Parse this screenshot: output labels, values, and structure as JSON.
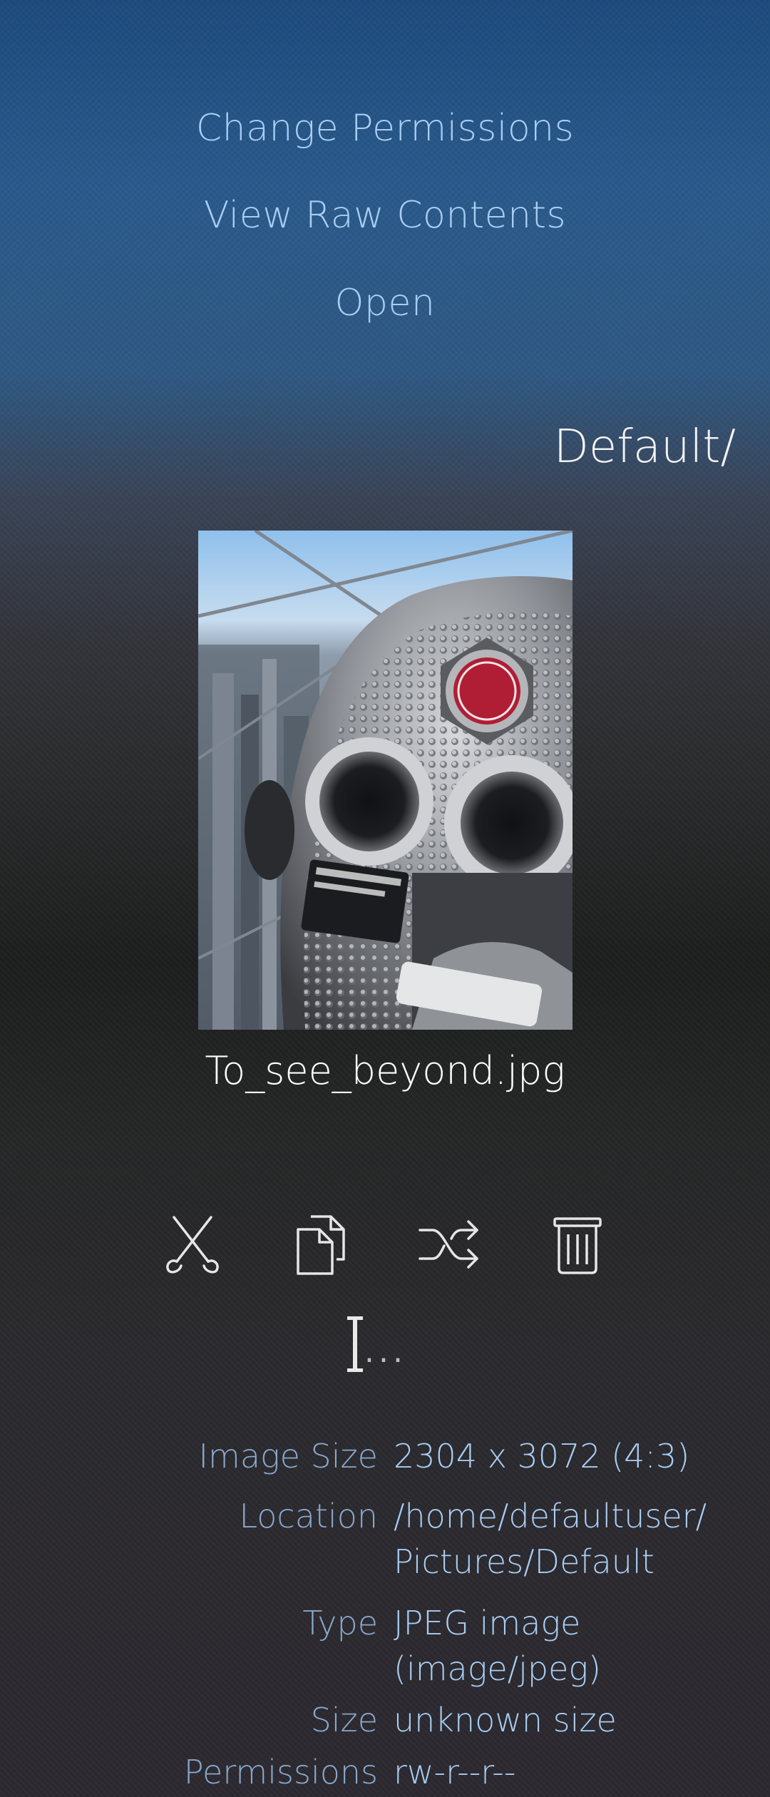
{
  "menu": {
    "items": [
      {
        "label": "Change Permissions"
      },
      {
        "label": "View Raw Contents"
      },
      {
        "label": "Open"
      }
    ]
  },
  "header": {
    "folder": "Default/"
  },
  "file": {
    "name": "To_see_beyond.jpg"
  },
  "actions": {
    "cut_icon": "scissors-icon",
    "copy_icon": "copy-icon",
    "shuffle_icon": "shuffle-icon",
    "delete_icon": "trash-icon"
  },
  "rename": {
    "dots": "..."
  },
  "details": {
    "image_size": {
      "label": "Image Size",
      "value": "2304 x 3072 (4:3)"
    },
    "location": {
      "label": "Location",
      "value": "/home/defaultuser/ Pictures/Default"
    },
    "type": {
      "label": "Type",
      "value": "JPEG image (image/jpeg)"
    },
    "size": {
      "label": "Size",
      "value": "unknown size"
    },
    "permissions": {
      "label": "Permissions",
      "value": "rw-r--r--"
    }
  },
  "colors": {
    "accent": "#a9cdf3",
    "label": "#8aa8cc",
    "title": "#f2f2f2"
  }
}
